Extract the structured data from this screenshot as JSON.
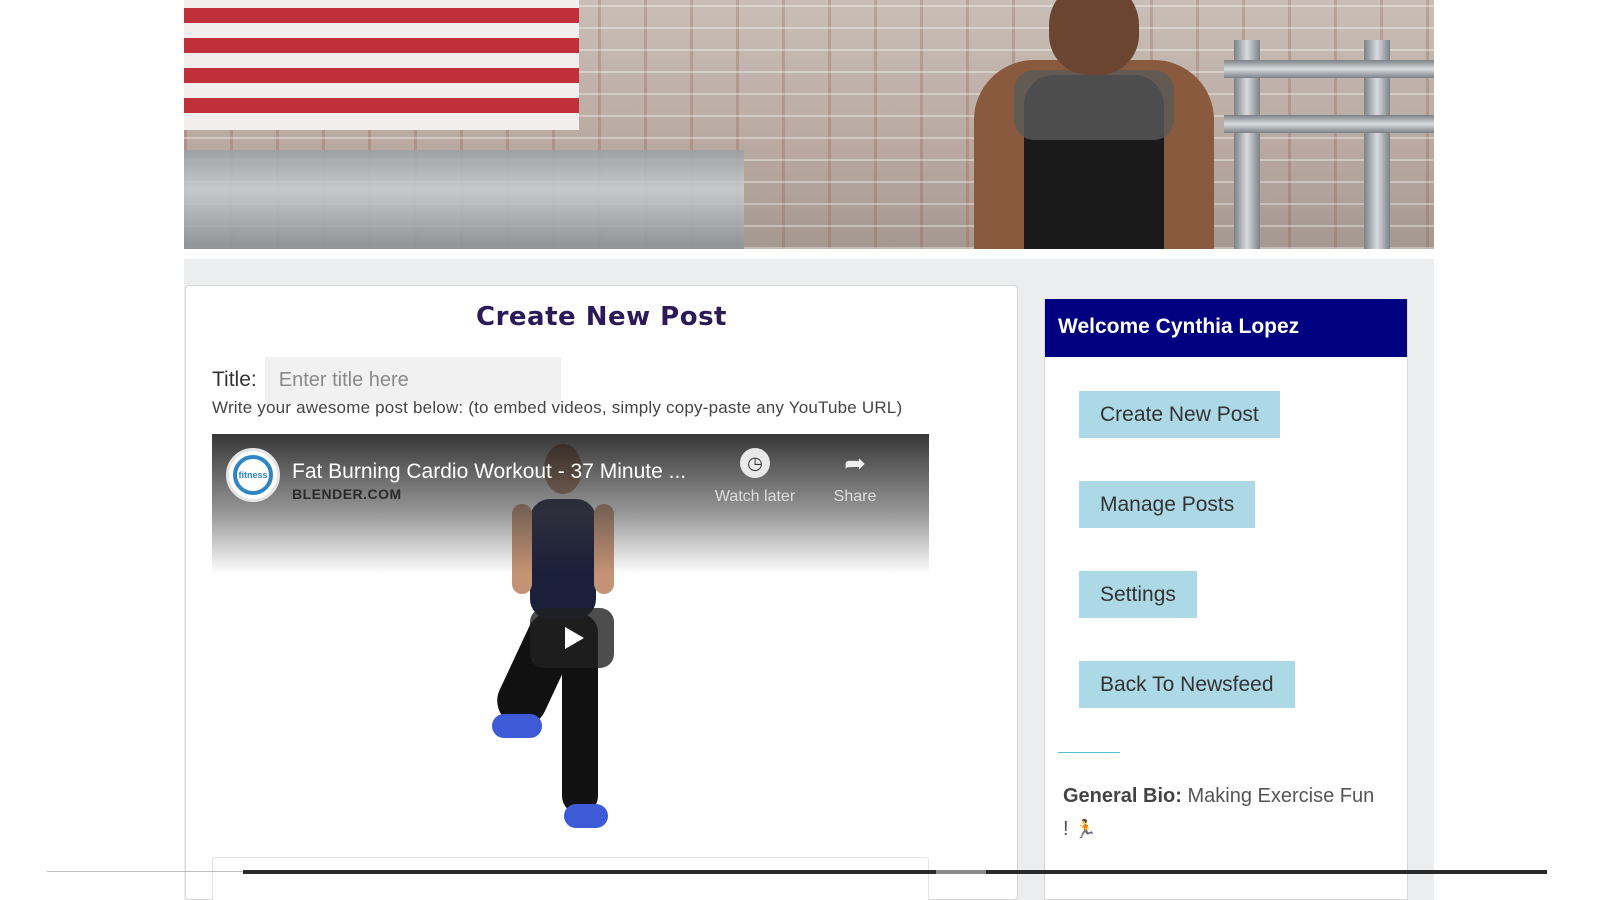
{
  "post": {
    "heading": "Create New Post",
    "title_label": "Title:",
    "title_placeholder": "Enter title here",
    "title_value": "",
    "instructions": "Write your awesome post below: (to embed videos, simply copy-paste any YouTube URL)"
  },
  "video": {
    "title": "Fat Burning Cardio Workout - 37 Minute ...",
    "channel_logo_text": "fitness",
    "channel_subtitle": "BLENDER.COM",
    "watch_later_label": "Watch later",
    "share_label": "Share"
  },
  "sidebar": {
    "welcome": "Welcome Cynthia Lopez",
    "buttons": [
      {
        "label": "Create New Post"
      },
      {
        "label": "Manage Posts"
      },
      {
        "label": "Settings"
      },
      {
        "label": "Back To Newsfeed"
      }
    ],
    "bio_label": "General Bio:",
    "bio_text": "Making Exercise Fun !",
    "bio_emoji": "🏃"
  },
  "colors": {
    "sidebar_header": "#000080",
    "button_bg": "#add8e6",
    "heading_text": "#2b1a57"
  }
}
